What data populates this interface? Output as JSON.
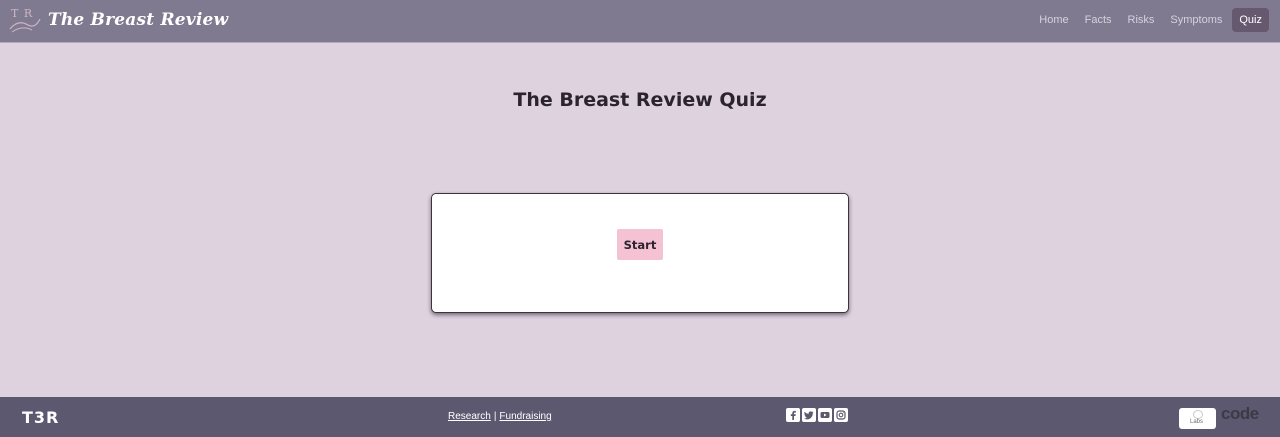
{
  "header": {
    "logo_letters": "T R",
    "brand_name": "The Breast Review",
    "nav": [
      {
        "label": "Home",
        "active": false
      },
      {
        "label": "Facts",
        "active": false
      },
      {
        "label": "Risks",
        "active": false
      },
      {
        "label": "Symptoms",
        "active": false
      },
      {
        "label": "Quiz",
        "active": true
      }
    ]
  },
  "main": {
    "title": "The Breast Review Quiz",
    "start_label": "Start"
  },
  "footer": {
    "logo_text": "T3R",
    "links": [
      {
        "label": "Research"
      },
      {
        "label": "Fundraising"
      }
    ],
    "separator": "|",
    "social_icons": [
      "facebook-icon",
      "twitter-icon",
      "youtube-icon",
      "instagram-icon"
    ],
    "sponsors": {
      "sponsor_1_text": "Labs",
      "sponsor_2_word": "code"
    }
  },
  "colors": {
    "header_bg": "#807a91",
    "page_bg": "#dfd2df",
    "footer_bg": "#5b5870",
    "active_nav_bg": "#66586e",
    "start_button_bg": "#f4c2d2",
    "code_accent": "#e24d3b"
  }
}
